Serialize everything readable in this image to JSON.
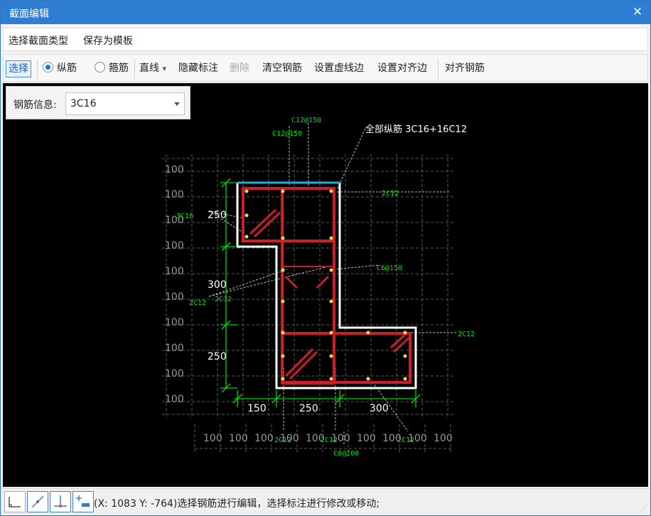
{
  "window": {
    "title": "截面编辑",
    "close_glyph": "✕"
  },
  "menu": {
    "items": [
      "选择截面类型",
      "保存为模板"
    ]
  },
  "toolbar": {
    "select_label": "选择",
    "longitudinal_label": "纵筋",
    "stirrup_label": "箍筋",
    "line_label": "直线",
    "line_arrow": "▾",
    "hide_dim_label": "隐藏标注",
    "delete_label": "删除",
    "clear_label": "清空钢筋",
    "dashed_edge_label": "设置虚线边",
    "align_edge_label": "设置对齐边",
    "align_rebar_label": "对齐钢筋"
  },
  "rebar_info": {
    "label": "钢筋信息:",
    "value": "3C16"
  },
  "drawing": {
    "grid_value": "100",
    "all_longitudinal_label": "全部纵筋 3C16+16C12",
    "labels": [
      "C12@150",
      "C12@150",
      "3C16",
      "2C12",
      "2C12",
      "2C12",
      "C6@150",
      "2C12",
      "2C12",
      "2C12",
      "C6@200",
      "2C12"
    ],
    "dim_vertical": [
      "250",
      "300",
      "250"
    ],
    "dim_horizontal": [
      "150",
      "250",
      "300"
    ],
    "colors": {
      "outline": "#ffffff",
      "top_edge": "#29a8e0",
      "rebar": "#cc1e2a",
      "rebar_dot": "#e8e050",
      "dimension": "#00d700",
      "annotation": "#00e000",
      "grid": "#5a5a5a"
    }
  },
  "status": {
    "text": "(X: 1083 Y: -764)选择钢筋进行编辑，选择标注进行修改或移动;"
  }
}
